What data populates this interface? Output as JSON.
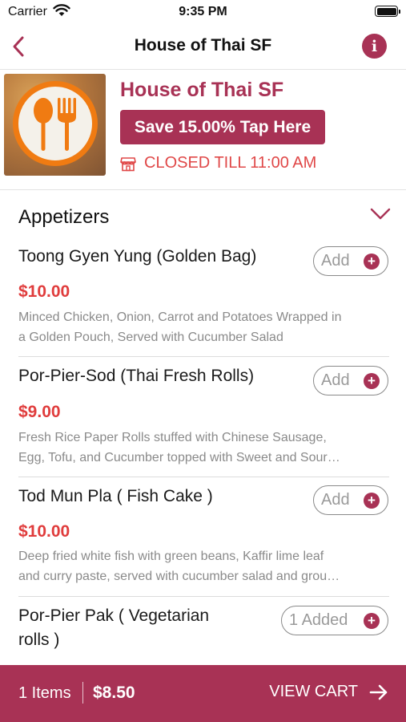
{
  "status_bar": {
    "carrier": "Carrier",
    "time": "9:35 PM",
    "icons": [
      "wifi-icon",
      "battery-icon"
    ]
  },
  "nav": {
    "title": "House of Thai SF",
    "back_icon": "chevron-left-icon",
    "info_icon": "info-icon",
    "info_glyph": "i"
  },
  "restaurant": {
    "name": "House of Thai SF",
    "promo_label": "Save 15.00% Tap Here",
    "status_icon": "store-icon",
    "status_text": "CLOSED TILL 11:00 AM",
    "logo_icon": "spoon-fork-icon"
  },
  "category": {
    "title": "Appetizers",
    "toggle_icon": "chevron-down-icon"
  },
  "items": [
    {
      "name": "Toong Gyen Yung (Golden Bag)",
      "price": "$10.00",
      "desc_line1": "Minced Chicken, Onion, Carrot and Potatoes Wrapped in",
      "desc_line2": "a Golden Pouch, Served with Cucumber Salad",
      "button_label": "Add"
    },
    {
      "name": "Por-Pier-Sod (Thai Fresh Rolls)",
      "price": "$9.00",
      "desc_line1": "Fresh Rice Paper Rolls stuffed with Chinese Sausage,",
      "desc_line2": "Egg, Tofu, and Cucumber topped with Sweet and Sour…",
      "button_label": "Add"
    },
    {
      "name": "Tod Mun Pla ( Fish Cake )",
      "price": "$10.00",
      "desc_line1": "Deep fried white fish with green beans, Kaffir lime leaf",
      "desc_line2": "and curry paste, served with cucumber salad and grou…",
      "button_label": "Add"
    },
    {
      "name_line1": "Por-Pier Pak ( Vegetarian",
      "name_line2": "rolls )",
      "button_label": "1 Added"
    }
  ],
  "cart": {
    "items_label": "1 Items",
    "total": "$8.50",
    "view_label": "VIEW CART",
    "arrow_icon": "arrow-right-icon"
  },
  "colors": {
    "brand": "#a83255",
    "price": "#e03c3c",
    "closed": "#e04848",
    "logo_orange": "#f07b12"
  }
}
